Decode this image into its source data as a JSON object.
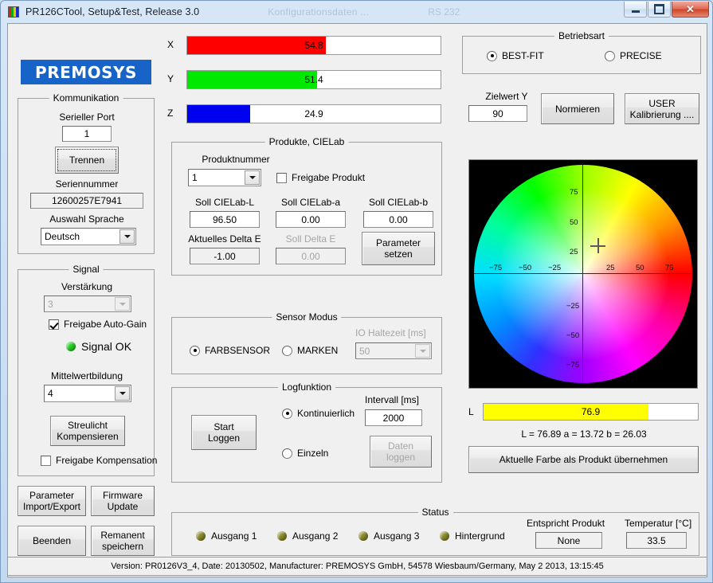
{
  "window": {
    "title": "PR126CTool, Setup&Test, Release 3.0",
    "ghost_text": "Konfigurationsdaten ...",
    "ghost_text2": "RS 232",
    "icon": "color-bars-icon",
    "minimize_label": "Minimieren",
    "maximize_label": "Maximieren",
    "close_label": "✕"
  },
  "logo": {
    "text": "PREMOSYS",
    "color": "#1763c8"
  },
  "kommunikation": {
    "caption": "Kommunikation",
    "port_label": "Serieller Port",
    "port_value": "1",
    "connect_button": "Trennen",
    "serial_label": "Seriennummer",
    "serial_value": "12600257E7941",
    "language_label": "Auswahl Sprache",
    "language_value": "Deutsch"
  },
  "signal": {
    "caption": "Signal",
    "gain_label": "Verstärkung",
    "gain_value": "3",
    "autogain_label": "Freigabe Auto-Gain",
    "autogain_checked": true,
    "status_label": "Signal OK",
    "status_color": "#22d422",
    "average_label": "Mittelwertbildung",
    "average_value": "4",
    "stray_button": "Streulicht\nKompensieren",
    "stray_button_l1": "Streulicht",
    "stray_button_l2": "Kompensieren",
    "compensation_label": "Freigabe Kompensation",
    "compensation_checked": false
  },
  "left_buttons": {
    "param_l1": "Parameter",
    "param_l2": "Import/Export",
    "firmware_l1": "Firmware",
    "firmware_l2": "Update",
    "quit": "Beenden",
    "remanent_l1": "Remanent",
    "remanent_l2": "speichern"
  },
  "xyz": {
    "bars": [
      {
        "name": "X",
        "value": "54.8",
        "percent": 54.8,
        "color": "#fe0000"
      },
      {
        "name": "Y",
        "value": "51.4",
        "percent": 51.4,
        "color": "#00e800"
      },
      {
        "name": "Z",
        "value": "24.9",
        "percent": 24.9,
        "color": "#0000f0"
      }
    ]
  },
  "produkte": {
    "caption": "Produkte, CIELab",
    "produktnummer_label": "Produktnummer",
    "produktnummer_value": "1",
    "freigabe_label": "Freigabe Produkt",
    "freigabe_checked": false,
    "soll_l_label": "Soll CIELab-L",
    "soll_l_value": "96.50",
    "soll_a_label": "Soll CIELab-a",
    "soll_a_value": "0.00",
    "soll_b_label": "Soll CIELab-b",
    "soll_b_value": "0.00",
    "delta_label": "Aktuelles Delta E",
    "delta_value": "-1.00",
    "soll_delta_label": "Soll Delta E",
    "soll_delta_value": "0.00",
    "param_button_l1": "Parameter",
    "param_button_l2": "setzen"
  },
  "sensor": {
    "caption": "Sensor Modus",
    "farbsensor_label": "FARBSENSOR",
    "marken_label": "MARKEN",
    "selected": "FARBSENSOR",
    "holdtime_label": "IO Haltezeit [ms]",
    "holdtime_value": "50"
  },
  "log": {
    "caption": "Logfunktion",
    "start_l1": "Start",
    "start_l2": "Loggen",
    "kontinuierlich_label": "Kontinuierlich",
    "einzeln_label": "Einzeln",
    "selected": "Kontinuierlich",
    "intervall_label": "Intervall [ms]",
    "intervall_value": "2000",
    "daten_l1": "Daten",
    "daten_l2": "loggen"
  },
  "betriebsart": {
    "caption": "Betriebsart",
    "bestfit_label": "BEST-FIT",
    "precise_label": "PRECISE",
    "selected": "BEST-FIT"
  },
  "zielwert": {
    "label": "Zielwert Y",
    "value": "90",
    "normieren_button": "Normieren",
    "user_cal_l1": "USER",
    "user_cal_l2": "Kalibrierung ...."
  },
  "color_display": {
    "l_label": "L",
    "l_value": "76.9",
    "l_percent": 76.9,
    "l_color": "#ffff00",
    "lab_text": "L = 76.89   a = 13.72   b = 26.03",
    "take_button": "Aktuelle Farbe als Produkt übernehmen",
    "crosshair_a": 13.72,
    "crosshair_b": 26.03,
    "axis_ticks_positive": [
      "25",
      "50",
      "75"
    ],
    "axis_ticks_negative": [
      "−25",
      "−50",
      "−75"
    ],
    "axis_max": 100
  },
  "status": {
    "caption": "Status",
    "leds": [
      {
        "label": "Ausgang 1",
        "color": "#8a8a2a"
      },
      {
        "label": "Ausgang 2",
        "color": "#8a8a2a"
      },
      {
        "label": "Ausgang 3",
        "color": "#8a8a2a"
      },
      {
        "label": "Hintergrund",
        "color": "#8a8a2a"
      }
    ],
    "entspricht_label": "Entspricht Produkt",
    "entspricht_value": "None",
    "temperatur_label": "Temperatur [°C]",
    "temperatur_value": "33.5"
  },
  "statusbar": {
    "text": "Version: PR0126V3_4, Date: 20130502, Manufacturer: PREMOSYS GmbH, 54578 Wiesbaum/Germany, May  2 2013, 13:15:45"
  }
}
